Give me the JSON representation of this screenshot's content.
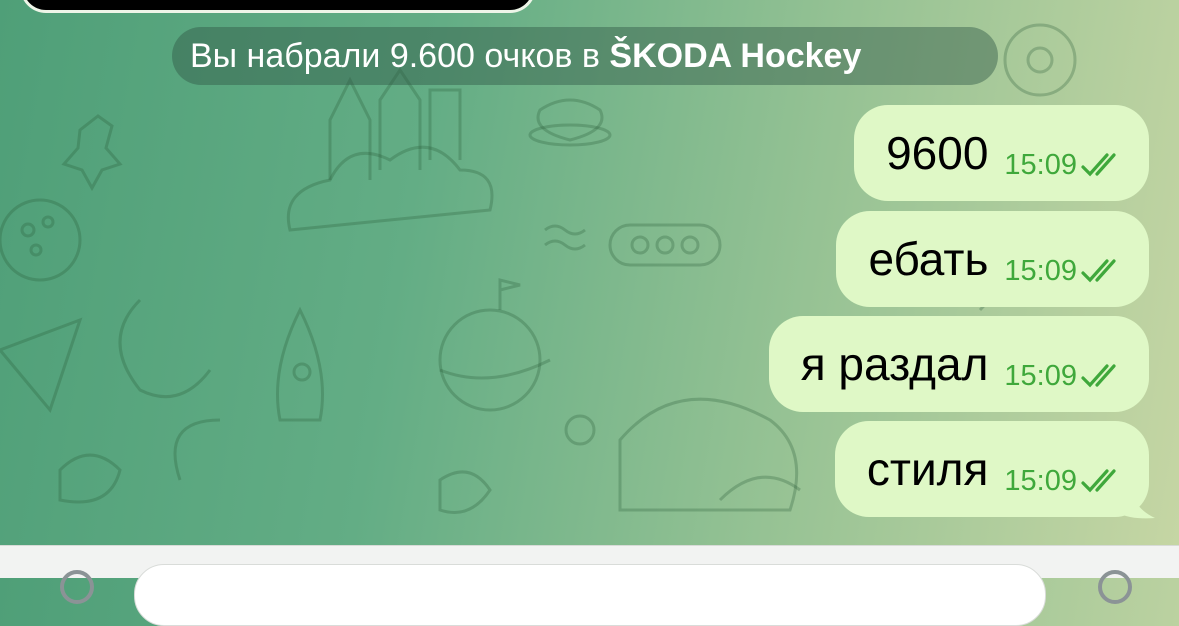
{
  "service_message": {
    "prefix": "Вы набрали 9.600 очков в",
    "game": "ŠKODA Hockey"
  },
  "messages": [
    {
      "text": "9600",
      "time": "15:09",
      "status_icon": "double-check-icon"
    },
    {
      "text": "ебать",
      "time": "15:09",
      "status_icon": "double-check-icon"
    },
    {
      "text": "я раздал",
      "time": "15:09",
      "status_icon": "double-check-icon"
    },
    {
      "text": "стиля",
      "time": "15:09",
      "status_icon": "double-check-icon"
    }
  ],
  "colors": {
    "outgoing_bubble": "#dff8c6",
    "time_and_checks": "#3fa83b",
    "wallpaper_left": "#4f9f78",
    "wallpaper_right": "#c6d6a4",
    "input_bar": "#f2f3f2"
  },
  "icons": {
    "attach": "paperclip-icon",
    "send": "microphone-icon",
    "wallpaper": "doodle-pattern"
  }
}
